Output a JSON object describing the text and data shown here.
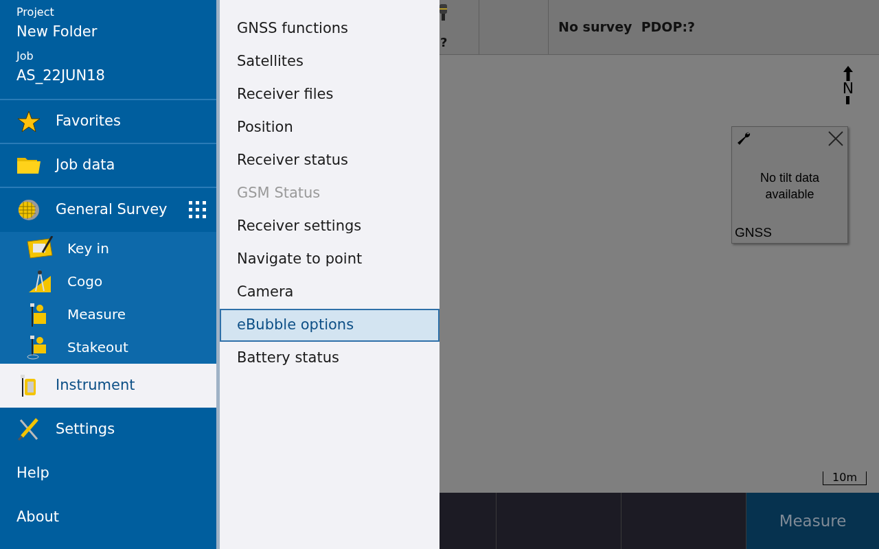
{
  "sidebar": {
    "project_label": "Project",
    "project": "New Folder",
    "job_label": "Job",
    "job": "AS_22JUN18",
    "items": [
      {
        "label": "Favorites",
        "kind": "main",
        "selected": false
      },
      {
        "label": "Job data",
        "kind": "main",
        "selected": false
      },
      {
        "label": "General Survey",
        "kind": "app",
        "selected": false
      },
      {
        "label": "Key in",
        "kind": "sub",
        "selected": false
      },
      {
        "label": "Cogo",
        "kind": "sub",
        "selected": false
      },
      {
        "label": "Measure",
        "kind": "sub",
        "selected": false
      },
      {
        "label": "Stakeout",
        "kind": "sub",
        "selected": false
      },
      {
        "label": "Instrument",
        "kind": "main",
        "selected": true
      },
      {
        "label": "Settings",
        "kind": "main",
        "selected": false
      },
      {
        "label": "Help",
        "kind": "plain",
        "selected": false
      },
      {
        "label": "About",
        "kind": "plain",
        "selected": false
      }
    ]
  },
  "submenu": [
    {
      "label": "GNSS functions",
      "disabled": false,
      "selected": false
    },
    {
      "label": "Satellites",
      "disabled": false,
      "selected": false
    },
    {
      "label": "Receiver files",
      "disabled": false,
      "selected": false
    },
    {
      "label": "Position",
      "disabled": false,
      "selected": false
    },
    {
      "label": "Receiver status",
      "disabled": false,
      "selected": false
    },
    {
      "label": "GSM Status",
      "disabled": true,
      "selected": false
    },
    {
      "label": "Receiver settings",
      "disabled": false,
      "selected": false
    },
    {
      "label": "Navigate to point",
      "disabled": false,
      "selected": false
    },
    {
      "label": "Camera",
      "disabled": false,
      "selected": false
    },
    {
      "label": "eBubble options",
      "disabled": false,
      "selected": true
    },
    {
      "label": "Battery status",
      "disabled": false,
      "selected": false
    }
  ],
  "status_bar": {
    "receiver_reading": "?",
    "survey_status": "No survey  PDOP:?"
  },
  "map": {
    "north_label": "N",
    "scale": "10m"
  },
  "tilt_panel": {
    "message": "No tilt data available",
    "footer": "GNSS"
  },
  "bottom_bar": {
    "measure_button": {
      "label": "Measure",
      "disabled": true
    }
  }
}
